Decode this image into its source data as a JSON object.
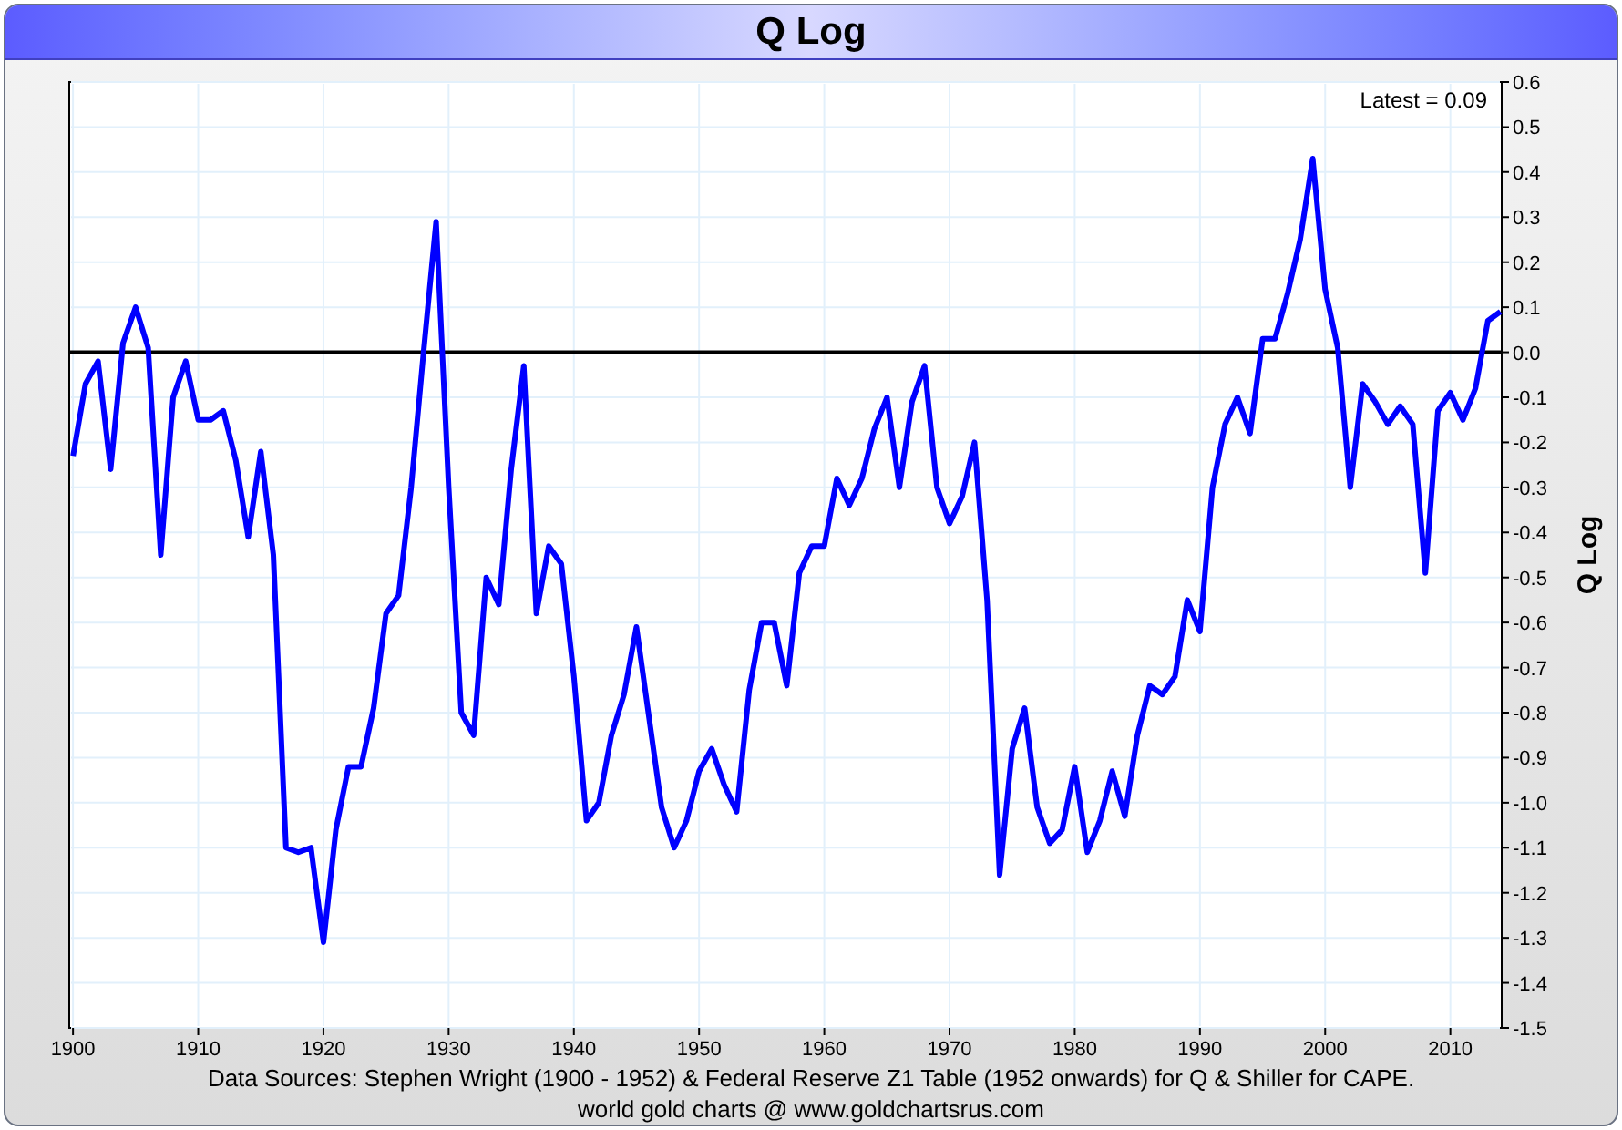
{
  "window": {
    "title": "Q Log"
  },
  "chart": {
    "chart_data": {
      "type": "line",
      "ylabel": "Q Log",
      "x": [
        1900,
        1901,
        1902,
        1903,
        1904,
        1905,
        1906,
        1907,
        1908,
        1909,
        1910,
        1911,
        1912,
        1913,
        1914,
        1915,
        1916,
        1917,
        1918,
        1919,
        1920,
        1921,
        1922,
        1923,
        1924,
        1925,
        1926,
        1927,
        1928,
        1929,
        1930,
        1931,
        1932,
        1933,
        1934,
        1935,
        1936,
        1937,
        1938,
        1939,
        1940,
        1941,
        1942,
        1943,
        1944,
        1945,
        1946,
        1947,
        1948,
        1949,
        1950,
        1951,
        1952,
        1953,
        1954,
        1955,
        1956,
        1957,
        1958,
        1959,
        1960,
        1961,
        1962,
        1963,
        1964,
        1965,
        1966,
        1967,
        1968,
        1969,
        1970,
        1971,
        1972,
        1973,
        1974,
        1975,
        1976,
        1977,
        1978,
        1979,
        1980,
        1981,
        1982,
        1983,
        1984,
        1985,
        1986,
        1987,
        1988,
        1989,
        1990,
        1991,
        1992,
        1993,
        1994,
        1995,
        1996,
        1997,
        1998,
        1999,
        2000,
        2001,
        2002,
        2003,
        2004,
        2005,
        2006,
        2007,
        2008,
        2009,
        2010,
        2011,
        2012,
        2013,
        2014
      ],
      "series": [
        {
          "color": "#0000ff",
          "values": [
            -0.23,
            -0.07,
            -0.02,
            -0.26,
            0.02,
            0.1,
            0.01,
            -0.45,
            -0.1,
            -0.02,
            -0.15,
            -0.15,
            -0.13,
            -0.24,
            -0.41,
            -0.22,
            -0.45,
            -1.1,
            -1.11,
            -1.1,
            -1.31,
            -1.06,
            -0.92,
            -0.92,
            -0.79,
            -0.58,
            -0.54,
            -0.3,
            0.0,
            0.29,
            -0.3,
            -0.8,
            -0.85,
            -0.5,
            -0.56,
            -0.26,
            -0.03,
            -0.58,
            -0.43,
            -0.47,
            -0.72,
            -1.04,
            -1.0,
            -0.85,
            -0.76,
            -0.61,
            -0.81,
            -1.01,
            -1.1,
            -1.04,
            -0.93,
            -0.88,
            -0.96,
            -1.02,
            -0.75,
            -0.6,
            -0.6,
            -0.74,
            -0.49,
            -0.43,
            -0.43,
            -0.28,
            -0.34,
            -0.28,
            -0.17,
            -0.1,
            -0.3,
            -0.11,
            -0.03,
            -0.3,
            -0.38,
            -0.32,
            -0.2,
            -0.55,
            -1.16,
            -0.88,
            -0.79,
            -1.01,
            -1.09,
            -1.06,
            -0.92,
            -1.11,
            -1.04,
            -0.93,
            -1.03,
            -0.85,
            -0.74,
            -0.76,
            -0.72,
            -0.55,
            -0.62,
            -0.3,
            -0.16,
            -0.1,
            -0.18,
            0.03,
            0.03,
            0.13,
            0.25,
            0.43,
            0.14,
            0.01,
            -0.3,
            -0.07,
            -0.11,
            -0.16,
            -0.12,
            -0.16,
            -0.49,
            -0.13,
            -0.09,
            -0.15,
            -0.08,
            0.07,
            0.09
          ]
        }
      ],
      "xticks": [
        1900,
        1910,
        1920,
        1930,
        1940,
        1950,
        1960,
        1970,
        1980,
        1990,
        2000,
        2010
      ],
      "yticks": [
        {
          "value": 0.6,
          "label": "0.6"
        },
        {
          "value": 0.5,
          "label": "0.5"
        },
        {
          "value": 0.4,
          "label": "0.4"
        },
        {
          "value": 0.3,
          "label": "0.3"
        },
        {
          "value": 0.2,
          "label": "0.2"
        },
        {
          "value": 0.1,
          "label": "0.1"
        },
        {
          "value": 0,
          "label": "0.0"
        },
        {
          "value": -0.1,
          "label": "-0.1"
        },
        {
          "value": -0.2,
          "label": "-0.2"
        },
        {
          "value": -0.3,
          "label": "-0.3"
        },
        {
          "value": -0.4,
          "label": "-0.4"
        },
        {
          "value": -0.5,
          "label": "-0.5"
        },
        {
          "value": -0.6,
          "label": "-0.6"
        },
        {
          "value": -0.7,
          "label": "-0.7"
        },
        {
          "value": -0.8,
          "label": "-0.8"
        },
        {
          "value": -0.9,
          "label": "-0.9"
        },
        {
          "value": -1,
          "label": "-1.0"
        },
        {
          "value": -1.1,
          "label": "-1.1"
        },
        {
          "value": -1.2,
          "label": "-1.2"
        },
        {
          "value": -1.3,
          "label": "-1.3"
        },
        {
          "value": -1.4,
          "label": "-1.4"
        },
        {
          "value": -1.5,
          "label": "-1.5"
        }
      ],
      "ylim": [
        -1.5,
        0.6
      ],
      "xlim": [
        1899.7,
        2014.1
      ],
      "grid": true,
      "annotations": [
        "Latest = 0.09"
      ]
    }
  },
  "footer": {
    "source": "Data Sources: Stephen Wright (1900 - 1952) & Federal Reserve Z1 Table (1952 onwards) for Q & Shiller for CAPE.",
    "credit": "world gold charts @ www.goldchartsrus.com"
  }
}
